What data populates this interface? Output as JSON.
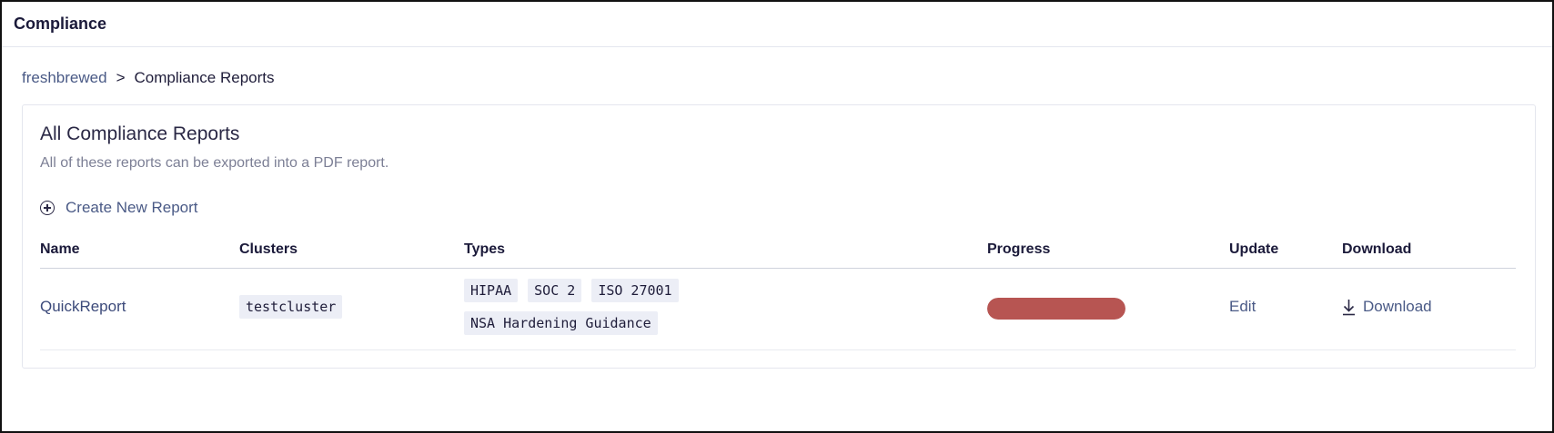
{
  "header": {
    "title": "Compliance"
  },
  "breadcrumb": {
    "parent": "freshbrewed",
    "separator": ">",
    "current": "Compliance Reports"
  },
  "card": {
    "title": "All Compliance Reports",
    "subtitle": "All of these reports can be exported into a PDF report.",
    "create_label": "Create New Report"
  },
  "table": {
    "columns": [
      "Name",
      "Clusters",
      "Types",
      "Progress",
      "Update",
      "Download"
    ],
    "rows": [
      {
        "name": "QuickReport",
        "cluster": "testcluster",
        "types": [
          "HIPAA",
          "SOC 2",
          "ISO 27001",
          "NSA Hardening Guidance"
        ],
        "progress": 1.0,
        "update_label": "Edit",
        "download_label": "Download"
      }
    ]
  },
  "colors": {
    "progress_fill": "#b75552",
    "link": "#4a5a86",
    "tag_bg": "#eceef6"
  },
  "icons": {
    "create": "plus-circle-icon",
    "download": "download-icon"
  }
}
